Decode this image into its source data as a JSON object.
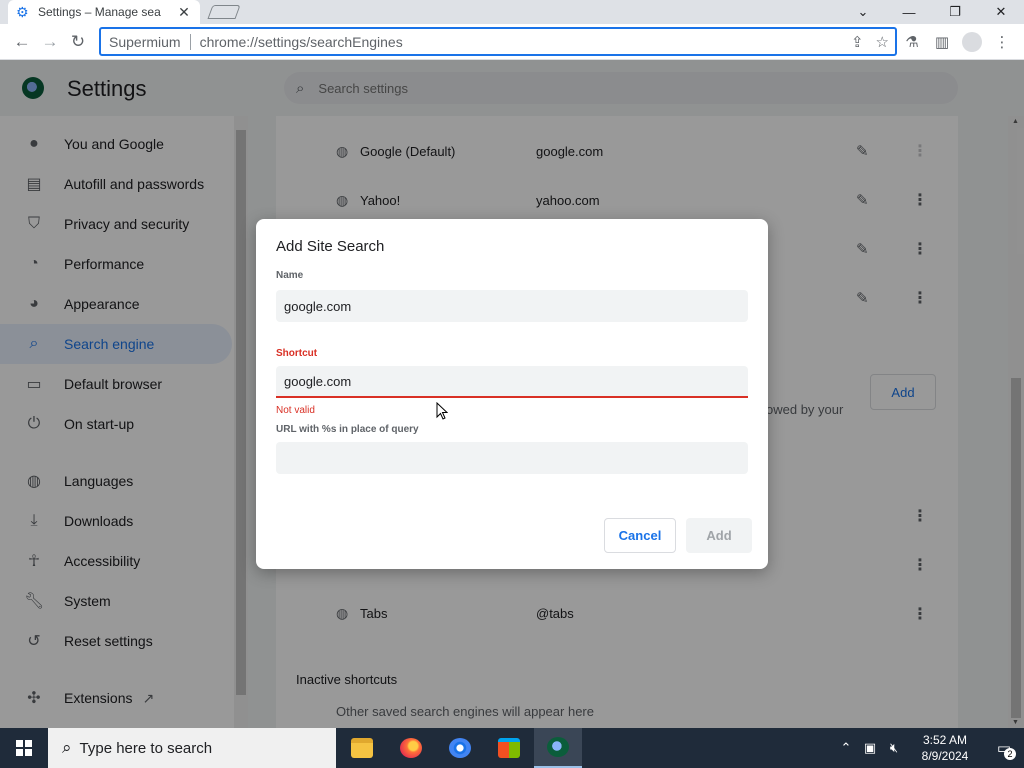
{
  "browser": {
    "tab_title": "Settings – Manage sea",
    "tab_close": "✕",
    "window_controls": {
      "chevron": "⌄",
      "minimize": "—",
      "maximize": "❐",
      "close": "✕"
    },
    "nav": {
      "back": "←",
      "forward": "→",
      "reload": "↻"
    },
    "omnibox": {
      "origin": "Supermium",
      "url": "chrome://settings/searchEngines"
    }
  },
  "settings": {
    "title": "Settings",
    "search_placeholder": "Search settings",
    "sidebar": {
      "items": [
        {
          "label": "You and Google",
          "icon": "person-icon"
        },
        {
          "label": "Autofill and passwords",
          "icon": "clipboard-icon"
        },
        {
          "label": "Privacy and security",
          "icon": "shield-icon"
        },
        {
          "label": "Performance",
          "icon": "speedometer-icon"
        },
        {
          "label": "Appearance",
          "icon": "palette-icon"
        },
        {
          "label": "Search engine",
          "icon": "search-icon",
          "active": true
        },
        {
          "label": "Default browser",
          "icon": "browser-icon"
        },
        {
          "label": "On start-up",
          "icon": "power-icon"
        },
        {
          "label": "Languages",
          "icon": "globe-icon"
        },
        {
          "label": "Downloads",
          "icon": "download-icon"
        },
        {
          "label": "Accessibility",
          "icon": "accessibility-icon"
        },
        {
          "label": "System",
          "icon": "wrench-icon"
        },
        {
          "label": "Reset settings",
          "icon": "history-icon"
        },
        {
          "label": "Extensions",
          "icon": "puzzle-icon"
        }
      ]
    },
    "engines": [
      {
        "name": "Google (Default)",
        "keyword": "google.com"
      },
      {
        "name": "Yahoo!",
        "keyword": "yahoo.com"
      },
      {
        "name": "Tabs",
        "keyword": "@tabs"
      }
    ],
    "add_button": "Add",
    "partial_text": "owed by your",
    "inactive_title": "Inactive shortcuts",
    "inactive_sub": "Other saved search engines will appear here"
  },
  "dialog": {
    "title": "Add Site Search",
    "name_label": "Name",
    "name_value": "google.com",
    "shortcut_label": "Shortcut",
    "shortcut_value": "google.com",
    "error": "Not valid",
    "url_label": "URL with %s in place of query",
    "url_value": "",
    "cancel": "Cancel",
    "add": "Add"
  },
  "taskbar": {
    "search_placeholder": "Type here to search",
    "time": "3:52 AM",
    "date": "8/9/2024",
    "notifications": "2"
  },
  "colors": {
    "accent": "#1a73e8",
    "error": "#d93025",
    "taskbar": "#1f2b3a"
  }
}
